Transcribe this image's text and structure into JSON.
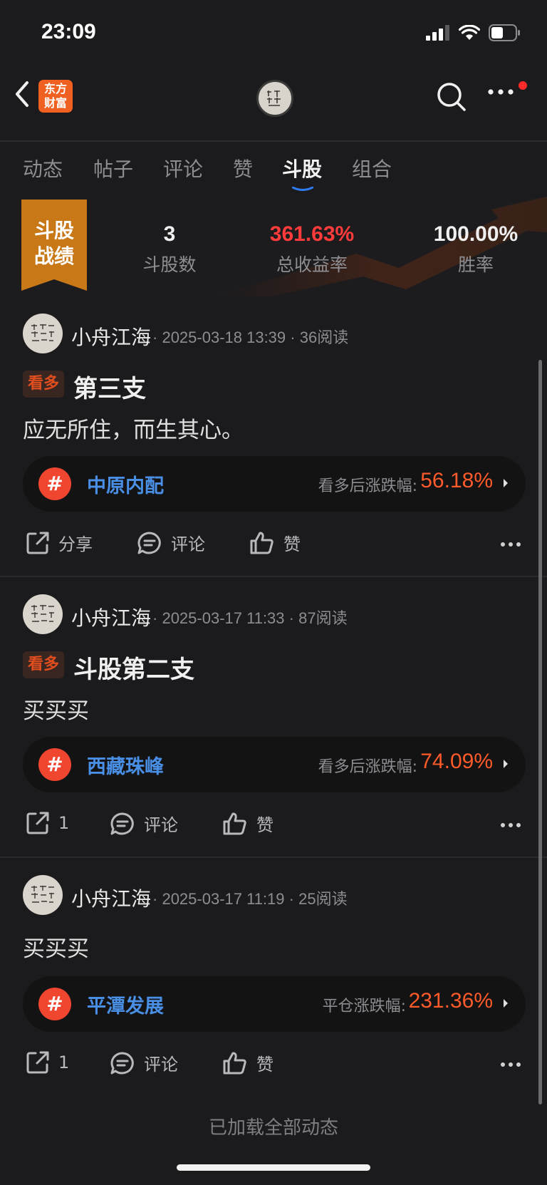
{
  "status_bar": {
    "time": "23:09",
    "battery_level": 0.45
  },
  "nav": {
    "logo_line1": "东方",
    "logo_line2": "财富",
    "logo_color": "#f06020"
  },
  "tabs": [
    {
      "label": "动态",
      "active": false
    },
    {
      "label": "帖子",
      "active": false
    },
    {
      "label": "评论",
      "active": false
    },
    {
      "label": "赞",
      "active": false
    },
    {
      "label": "斗股",
      "active": true
    },
    {
      "label": "组合",
      "active": false
    }
  ],
  "record": {
    "badge_line1": "斗股",
    "badge_line2": "战绩",
    "stats": [
      {
        "value": "3",
        "label": "斗股数"
      },
      {
        "value": "361.63%",
        "label": "总收益率"
      },
      {
        "value": "100.00%",
        "label": "胜率"
      }
    ]
  },
  "posts": [
    {
      "author": "小舟江海",
      "date": "2025-03-18 13:39",
      "reads": "36阅读",
      "tag": "看多",
      "title": "第三支",
      "body": "应无所住，而生其心。",
      "stock": {
        "name": "中原内配",
        "label": "看多后涨跌幅:",
        "pct": "56.18%"
      },
      "share_label": "分享",
      "comment_label": "评论",
      "like_label": "赞"
    },
    {
      "author": "小舟江海",
      "date": "2025-03-17 11:33",
      "reads": "87阅读",
      "tag": "看多",
      "title": "斗股第二支",
      "body": "买买买",
      "stock": {
        "name": "西藏珠峰",
        "label": "看多后涨跌幅:",
        "pct": "74.09%"
      },
      "share_label": "1",
      "comment_label": "评论",
      "like_label": "赞"
    },
    {
      "author": "小舟江海",
      "date": "2025-03-17 11:19",
      "reads": "25阅读",
      "body": "买买买",
      "stock": {
        "name": "平潭发展",
        "label": "平仓涨跌幅:",
        "pct": "231.36%"
      },
      "share_label": "1",
      "comment_label": "评论",
      "like_label": "赞"
    }
  ],
  "footer": "已加载全部动态",
  "colors": {
    "accent_red": "#ff5a2a",
    "stock_blue": "#4a8fe6",
    "badge_orange": "#c97818",
    "tab_active_blue": "#2e7bf0"
  }
}
